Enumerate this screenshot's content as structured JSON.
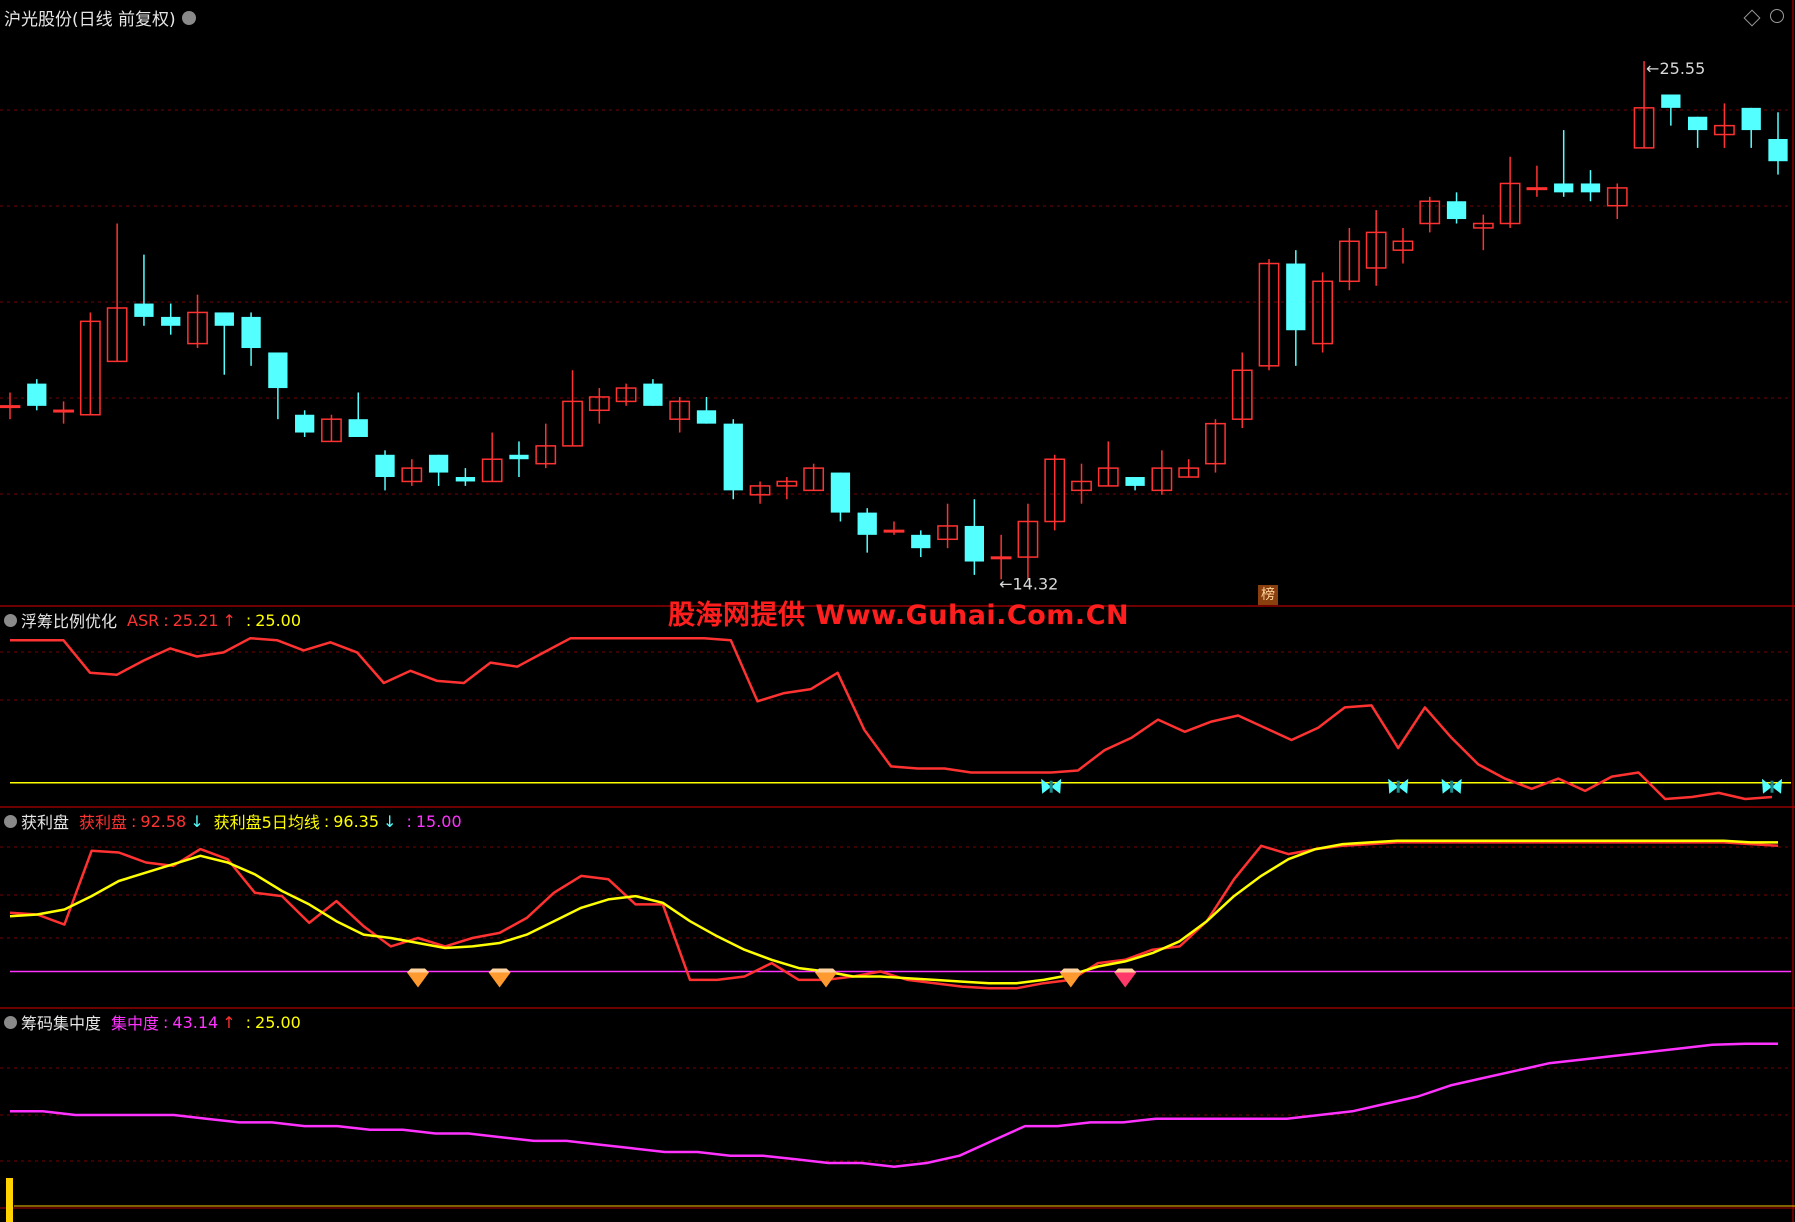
{
  "title": "沪光股份(日线 前复权)",
  "watermark": "股海网提供 Www.Guhai.Com.CN",
  "bang_label": "榜",
  "colors": {
    "up": "#ff3232",
    "down": "#54ffff",
    "grid": "#7a0000",
    "yellow": "#ffff00",
    "magenta": "#ff32ff",
    "text": "#c8c8c8"
  },
  "chart_data": [
    {
      "type": "candlestick",
      "title": "沪光股份(日线 前复权)",
      "high_label": "25.55",
      "low_label": "14.32",
      "high_index": 61,
      "low_index": 37,
      "ylim": [
        13.3,
        26.7
      ],
      "candles": [
        [
          17.8,
          17.8,
          18.1,
          17.5
        ],
        [
          18.3,
          17.8,
          18.4,
          17.7
        ],
        [
          17.7,
          17.7,
          17.9,
          17.4
        ],
        [
          17.6,
          19.7,
          19.9,
          17.6
        ],
        [
          18.8,
          20.0,
          21.9,
          18.8
        ],
        [
          20.1,
          19.8,
          21.2,
          19.6
        ],
        [
          19.8,
          19.6,
          20.1,
          19.4
        ],
        [
          19.2,
          19.9,
          20.3,
          19.1
        ],
        [
          19.9,
          19.6,
          19.9,
          18.5
        ],
        [
          19.8,
          19.1,
          19.9,
          18.7
        ],
        [
          19.0,
          18.2,
          19.0,
          17.5
        ],
        [
          17.6,
          17.2,
          17.7,
          17.1
        ],
        [
          17.0,
          17.5,
          17.6,
          17.0
        ],
        [
          17.5,
          17.1,
          18.1,
          17.1
        ],
        [
          16.7,
          16.2,
          16.8,
          15.9
        ],
        [
          16.1,
          16.4,
          16.6,
          16.0
        ],
        [
          16.7,
          16.3,
          16.7,
          16.0
        ],
        [
          16.2,
          16.1,
          16.4,
          16.0
        ],
        [
          16.1,
          16.6,
          17.2,
          16.1
        ],
        [
          16.7,
          16.6,
          17.0,
          16.2
        ],
        [
          16.5,
          16.9,
          17.4,
          16.4
        ],
        [
          16.9,
          17.9,
          18.6,
          16.9
        ],
        [
          17.7,
          18.0,
          18.2,
          17.4
        ],
        [
          17.9,
          18.2,
          18.3,
          17.8
        ],
        [
          18.3,
          17.8,
          18.4,
          17.8
        ],
        [
          17.5,
          17.9,
          18.0,
          17.2
        ],
        [
          17.7,
          17.4,
          18.0,
          17.4
        ],
        [
          17.4,
          15.9,
          17.5,
          15.7
        ],
        [
          15.8,
          16.0,
          16.1,
          15.6
        ],
        [
          16.0,
          16.1,
          16.2,
          15.7
        ],
        [
          15.9,
          16.4,
          16.5,
          15.9
        ],
        [
          16.3,
          15.4,
          16.3,
          15.2
        ],
        [
          15.4,
          14.9,
          15.5,
          14.5
        ],
        [
          15.0,
          15.0,
          15.2,
          14.9
        ],
        [
          14.9,
          14.6,
          15.0,
          14.4
        ],
        [
          14.8,
          15.1,
          15.6,
          14.6
        ],
        [
          15.1,
          14.3,
          15.7,
          14.0
        ],
        [
          14.4,
          14.4,
          14.9,
          13.9
        ],
        [
          14.4,
          15.2,
          15.6,
          13.9
        ],
        [
          15.2,
          16.6,
          16.7,
          15.0
        ],
        [
          15.9,
          16.1,
          16.5,
          15.6
        ],
        [
          16.0,
          16.4,
          17.0,
          16.0
        ],
        [
          16.2,
          16.0,
          16.2,
          15.9
        ],
        [
          15.9,
          16.4,
          16.8,
          15.8
        ],
        [
          16.2,
          16.4,
          16.6,
          16.2
        ],
        [
          16.5,
          17.4,
          17.5,
          16.3
        ],
        [
          17.5,
          18.6,
          19.0,
          17.3
        ],
        [
          18.7,
          21.0,
          21.1,
          18.6
        ],
        [
          21.0,
          19.5,
          21.3,
          18.7
        ],
        [
          19.2,
          20.6,
          20.8,
          19.0
        ],
        [
          20.6,
          21.5,
          21.8,
          20.4
        ],
        [
          20.9,
          21.7,
          22.2,
          20.5
        ],
        [
          21.3,
          21.5,
          21.8,
          21.0
        ],
        [
          21.9,
          22.4,
          22.5,
          21.7
        ],
        [
          22.4,
          22.0,
          22.6,
          21.9
        ],
        [
          21.8,
          21.9,
          22.1,
          21.3
        ],
        [
          21.9,
          22.8,
          23.4,
          21.8
        ],
        [
          22.7,
          22.7,
          23.2,
          22.5
        ],
        [
          22.8,
          22.6,
          24.0,
          22.5
        ],
        [
          22.8,
          22.6,
          23.1,
          22.4
        ],
        [
          22.3,
          22.7,
          22.8,
          22.0
        ],
        [
          23.6,
          24.5,
          25.55,
          23.6
        ],
        [
          24.8,
          24.5,
          24.8,
          24.1
        ],
        [
          24.3,
          24.0,
          24.3,
          23.6
        ],
        [
          23.9,
          24.1,
          24.6,
          23.6
        ],
        [
          24.5,
          24.0,
          24.5,
          23.6
        ],
        [
          23.8,
          23.3,
          24.4,
          23.0
        ]
      ]
    },
    {
      "type": "line",
      "title": "浮筹比例优化",
      "indicator": "ASR",
      "value": "25.21",
      "ref_value": "25.00",
      "ylim": [
        21,
        63
      ],
      "reference_line": 25,
      "series": [
        {
          "name": "ASR",
          "values": [
            60,
            60,
            60,
            52,
            51.5,
            55,
            58,
            56,
            57,
            60.5,
            60,
            57.5,
            59.5,
            57,
            49.5,
            52.5,
            50,
            49.5,
            54.5,
            53.5,
            57,
            60.5,
            60.5,
            60.5,
            60.5,
            60.5,
            60.5,
            60,
            45,
            47,
            48,
            52,
            38,
            29,
            28.5,
            28.5,
            27.5,
            27.5,
            27.5,
            27.5,
            28,
            33,
            36,
            40.5,
            37.5,
            40,
            41.5,
            38.5,
            35.5,
            38.5,
            43.5,
            44,
            33.5,
            43.5,
            36,
            29.5,
            26,
            23.5,
            26,
            23,
            26.5,
            27.5,
            21,
            21.5,
            22.5,
            21,
            21.5
          ]
        }
      ],
      "markers": [
        39,
        52,
        54,
        66
      ]
    },
    {
      "type": "line",
      "title": "获利盘",
      "series": [
        {
          "name": "获利盘",
          "label_value": "92.58",
          "values": [
            50,
            49,
            43,
            87,
            86,
            80,
            78,
            88,
            82,
            62,
            60,
            44,
            57,
            42,
            30,
            35,
            30,
            35,
            38,
            47,
            62,
            72,
            70,
            55,
            55,
            10,
            10,
            12,
            20,
            10,
            10,
            12,
            15,
            10,
            8,
            6,
            5,
            5,
            8,
            10,
            20,
            22,
            28,
            30,
            45,
            70,
            90,
            85,
            88,
            90,
            91,
            92,
            92,
            92,
            92,
            92,
            92,
            92,
            92,
            92,
            92,
            92,
            92,
            92,
            91,
            90
          ]
        },
        {
          "name": "获利盘5日均线",
          "label_value": "96.35",
          "values": [
            48,
            49,
            52,
            60,
            69,
            74,
            79,
            84,
            80,
            73,
            63,
            55,
            45,
            37,
            35,
            32,
            29,
            30,
            32,
            37,
            45,
            53,
            58,
            60,
            56,
            45,
            36,
            28,
            22,
            17,
            15,
            12,
            12,
            11,
            10,
            9,
            8,
            8,
            10,
            13,
            18,
            21,
            26,
            33,
            45,
            60,
            72,
            82,
            88,
            91,
            92,
            93,
            93,
            93,
            93,
            93,
            93,
            93,
            93,
            93,
            93,
            93,
            93,
            93,
            92,
            92
          ]
        }
      ],
      "ref_value": "15.00",
      "ylim": [
        -2,
        100
      ],
      "reference_line": 15,
      "markers": [
        15,
        18,
        30,
        39,
        41
      ]
    },
    {
      "type": "line",
      "title": "筹码集中度",
      "indicator": "集中度",
      "value": "43.14",
      "ref_value": "25.00",
      "ylim": [
        22,
        45
      ],
      "reference_line": 25,
      "series": [
        {
          "name": "集中度",
          "values": [
            34,
            34,
            33.5,
            33.5,
            33.5,
            33.5,
            33,
            32.5,
            32.5,
            32,
            32,
            31.5,
            31.5,
            31,
            31,
            30.5,
            30,
            30,
            29.5,
            29,
            28.5,
            28.5,
            28,
            28,
            27.5,
            27,
            27,
            26.5,
            27,
            28,
            30,
            32,
            32,
            32.5,
            32.5,
            33,
            33,
            33,
            33,
            33,
            33.5,
            34,
            35,
            36,
            37.5,
            38.5,
            39.5,
            40.5,
            41,
            41.5,
            42,
            42.5,
            43,
            43.14,
            43.14
          ]
        }
      ]
    }
  ]
}
